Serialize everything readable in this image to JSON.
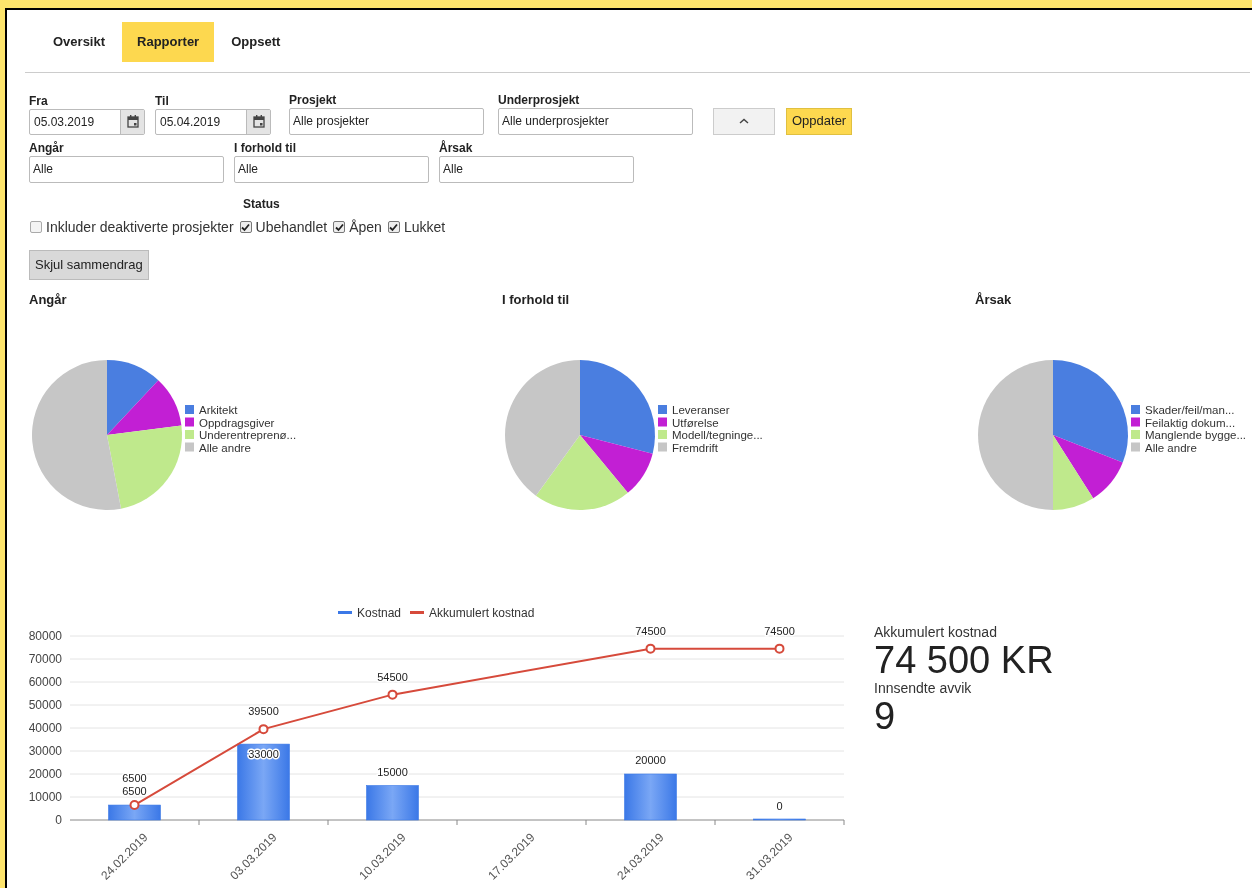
{
  "tabs": [
    {
      "label": "Oversikt",
      "selected": false
    },
    {
      "label": "Rapporter",
      "selected": true
    },
    {
      "label": "Oppsett",
      "selected": false
    }
  ],
  "filters_row_1": [
    {
      "kind": "date",
      "label": "Fra",
      "value": "05.03.2019"
    },
    {
      "kind": "date",
      "label": "Til",
      "value": "05.04.2019"
    },
    {
      "kind": "select",
      "label": "Prosjekt",
      "value": "Alle prosjekter"
    },
    {
      "kind": "select",
      "label": "Underprosjekt",
      "value": "Alle underprosjekter"
    }
  ],
  "update_button": "Oppdater",
  "filters_row_2": [
    {
      "kind": "select",
      "label": "Angår",
      "value": "Alle"
    },
    {
      "kind": "select",
      "label": "I forhold til",
      "value": "Alle"
    },
    {
      "kind": "select",
      "label": "Årsak",
      "value": "Alle"
    }
  ],
  "status_label": "Status",
  "checkboxes": [
    {
      "label": "Inkluder deaktiverte prosjekter",
      "checked": false
    },
    {
      "label": "Ubehandlet",
      "checked": true
    },
    {
      "label": "Åpen",
      "checked": true
    },
    {
      "label": "Lukket",
      "checked": true
    }
  ],
  "summary_button": "Skjul sammendrag",
  "pies": [
    {
      "title": "Angår",
      "chart_data": {
        "type": "pie",
        "categories": [
          "Arkitekt",
          "Oppdragsgiver",
          "Underentreprenø...",
          "Alle andre"
        ],
        "colors": [
          "#4a7ee0",
          "#c21fd4",
          "#bfe98c",
          "#c6c6c6"
        ],
        "values": [
          12,
          11,
          24,
          53
        ],
        "legend": "right"
      }
    },
    {
      "title": "I forhold til",
      "chart_data": {
        "type": "pie",
        "categories": [
          "Leveranser",
          "Utførelse",
          "Modell/tegninge...",
          "Fremdrift"
        ],
        "colors": [
          "#4a7ee0",
          "#c21fd4",
          "#bfe98c",
          "#c6c6c6"
        ],
        "values": [
          29,
          10,
          21,
          40
        ],
        "legend": "right"
      }
    },
    {
      "title": "Årsak",
      "chart_data": {
        "type": "pie",
        "categories": [
          "Skader/feil/man...",
          "Feilaktig dokum...",
          "Manglende bygge...",
          "Alle andre"
        ],
        "colors": [
          "#4a7ee0",
          "#c21fd4",
          "#bfe98c",
          "#c6c6c6"
        ],
        "values": [
          31,
          10,
          9,
          50
        ],
        "legend": "right"
      }
    }
  ],
  "cost_chart": {
    "chart_data": {
      "type": "bar",
      "categories": [
        "24.02.2019",
        "03.03.2019",
        "10.03.2019",
        "17.03.2019",
        "24.03.2019",
        "31.03.2019"
      ],
      "series": [
        {
          "name": "Kostnad",
          "type": "bar",
          "color": "#3b78e7",
          "values": [
            6500,
            33000,
            15000,
            null,
            20000,
            0
          ]
        },
        {
          "name": "Akkumulert kostnad",
          "type": "line",
          "marker": "circle",
          "color": "#d64a3b",
          "values": [
            6500,
            39500,
            54500,
            null,
            74500,
            74500
          ]
        }
      ],
      "ylim": [
        0,
        80000
      ],
      "yticks": [
        0,
        10000,
        20000,
        30000,
        40000,
        50000,
        60000,
        70000,
        80000
      ],
      "grid": true,
      "data_labels": true,
      "legend": "top"
    }
  },
  "stats": [
    {
      "label": "Akkumulert kostnad",
      "value": "74 500 KR"
    },
    {
      "label": "Innsendte avvik",
      "value": "9"
    }
  ]
}
